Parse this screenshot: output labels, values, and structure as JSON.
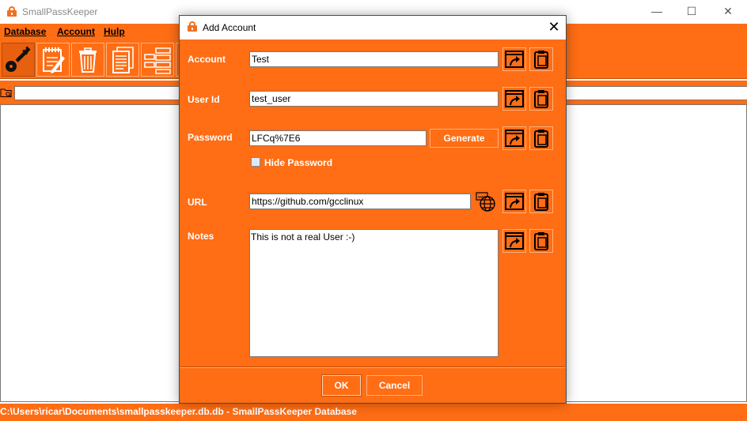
{
  "main_window": {
    "title": "SmallPassKeeper",
    "controls": {
      "minimize": "—",
      "maximize": "☐",
      "close": "✕"
    },
    "menu": [
      "Database",
      "Account",
      "Hulp"
    ],
    "toolbar_icons": [
      "key-icon",
      "edit-note-icon",
      "trash-icon",
      "document-icon",
      "database-rows-icon"
    ],
    "search_value": "",
    "status": "C:\\Users\\ricar\\Documents\\smallpasskeeper.db.db - SmallPassKeeper Database"
  },
  "dialog": {
    "title": "Add Account",
    "close": "✕",
    "account_label": "Account",
    "account_value": "Test",
    "userid_label": "User Id",
    "userid_value": "test_user",
    "password_label": "Password",
    "password_value": "LFCq%7E6",
    "generate_label": "Generate",
    "hide_password_label": "Hide Password",
    "hide_password_checked": false,
    "url_label": "URL",
    "url_value": "https://github.com/gcclinux",
    "notes_label": "Notes",
    "notes_value": "This is not a real User :-)",
    "ok_label": "OK",
    "cancel_label": "Cancel"
  },
  "colors": {
    "accent": "#ff6d14",
    "text_on_accent": "#ffffff"
  }
}
